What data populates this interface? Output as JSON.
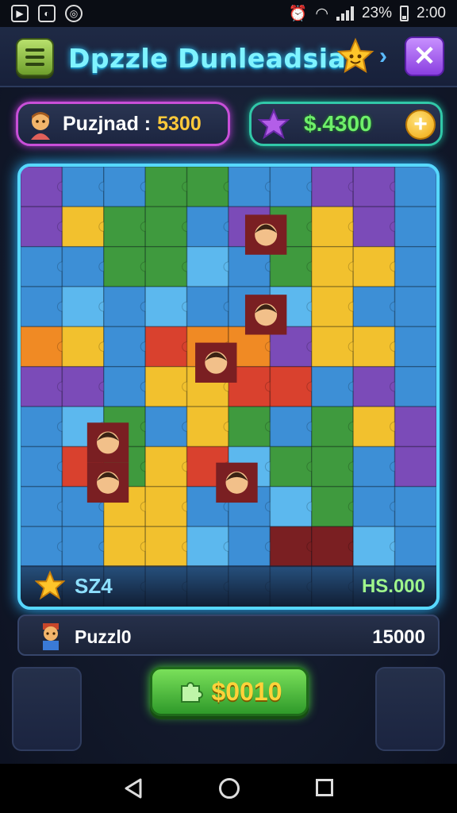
{
  "status_bar": {
    "battery": "23%",
    "time": "2:00"
  },
  "header": {
    "title": "Dpzzle Dunleadsia",
    "close_label": "✕",
    "menu_icon": "menu-list-icon",
    "star_icon": "star-icon"
  },
  "stats": {
    "player_label": "Puzjnad :",
    "player_value": "5300",
    "money": "$.4300",
    "plus_label": "+"
  },
  "board": {
    "moves": "SZ4",
    "score": "HS.000",
    "columns": 10,
    "rows": 11,
    "colors": {
      "blue": "#3d8fd6",
      "light_blue": "#5cb8ee",
      "green": "#3f9a3e",
      "yellow": "#f2c12e",
      "orange": "#f08a24",
      "red": "#d9412e",
      "purple": "#7b4bb8",
      "pink": "#d86aa8",
      "dark_red": "#7a1f22"
    }
  },
  "player": {
    "name": "Puzzl0",
    "points": "15000"
  },
  "buy_button": {
    "label": "$0010"
  },
  "accent_colors": {
    "frame": "#57d8ff",
    "title": "#7ff3ff",
    "money": "#6ef06a",
    "coin": "#ffc93a"
  }
}
